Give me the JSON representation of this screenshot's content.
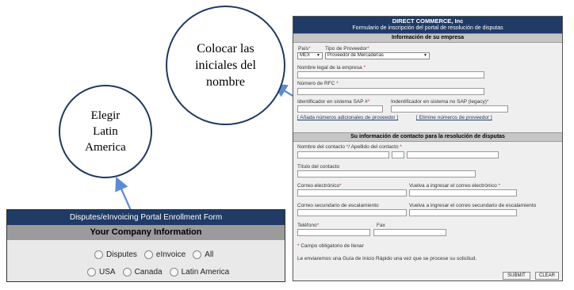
{
  "annotations": {
    "top_circle_text": "Colocar las\niniciales  del\nnombre",
    "bottom_circle_text": "Elegir\nLatin\nAmerica"
  },
  "enrollment_form": {
    "title": "Disputes/eInvoicing Portal Enrollment Form",
    "section": "Your Company Information",
    "row1": [
      "Disputes",
      "eInvoice",
      "All"
    ],
    "row2": [
      "USA",
      "Canada",
      "Latin America"
    ]
  },
  "dc_form": {
    "title": "DIRECT COMMERCE, Inc",
    "subtitle": "Formulario de inscripción del portal de resolución de disputas",
    "section_company": "Información de su empresa",
    "pais_label": "País",
    "pais_value": "MEX",
    "tipo_label": "Tipo de Proveedor",
    "tipo_value": "Proveedor de Mercaderías",
    "nombre_legal_label": "Nombre legal de la empresa",
    "rfc_label": "Número de RFC",
    "sap_label": "Identificador en sistema SAP #",
    "no_sap_label": "Indentificador en sistema no SAP (legacy)",
    "add_vendor_link": "[ Añada números adicionales de proveedor ]",
    "remove_vendor_link": "[ Elimine números de proveedor ]",
    "section_contact": "Su información de contacto para la resolución de disputas",
    "contact_name_label": "Nombre del contacto",
    "surname_label": "Apellido del contacto",
    "contact_title_label": "Título del contacto",
    "email_label": "Correo electrónico",
    "email_confirm_label": "Vuelva a ingresar el correo electrónico",
    "esc_email_label": "Correo secundario de escalamiento",
    "esc_email_confirm_label": "Vuelva a ingresar el correo secundario de escalamiento",
    "phone_label": "Teléfono",
    "fax_label": "Fax",
    "required_note": "Campo obligatorio de llenar",
    "guide_note": "Le enviaremos una Guía de Inicio Rápido una vez que se procese su solicitud.",
    "submit_label": "SUBMIT",
    "clear_label": "CLEAR"
  }
}
